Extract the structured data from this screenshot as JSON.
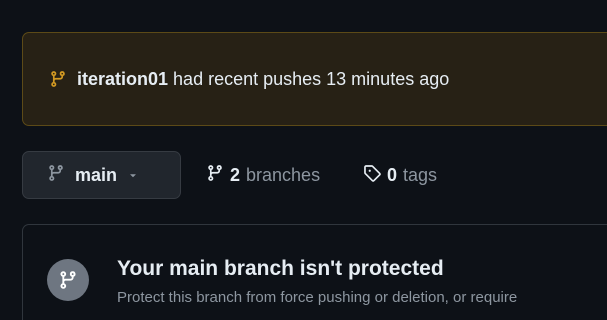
{
  "push_banner": {
    "branch": "iteration01",
    "message": "had recent pushes 13 minutes ago"
  },
  "branch_selector": {
    "current": "main"
  },
  "branches": {
    "count": "2",
    "label": "branches"
  },
  "tags": {
    "count": "0",
    "label": "tags"
  },
  "protection": {
    "title": "Your main branch isn't protected",
    "description": "Protect this branch from force pushing or deletion, or require"
  },
  "colors": {
    "background": "#0d1117",
    "banner_bg": "#272115",
    "banner_border": "#5c4a17",
    "banner_icon": "#d29922",
    "button_bg": "#21262d",
    "muted_text": "#8d96a0",
    "text": "#e6edf3"
  },
  "icons": {
    "banner": "git-branch-icon",
    "selector": "git-branch-icon",
    "caret": "triangle-down-icon",
    "branches": "git-branch-icon",
    "tags": "tag-icon",
    "protection": "git-branch-icon"
  }
}
